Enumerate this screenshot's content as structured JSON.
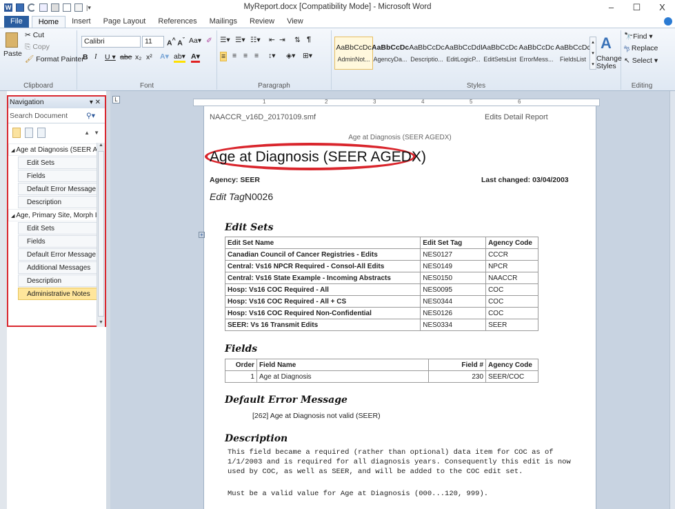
{
  "window": {
    "title": "MyReport.docx [Compatibility Mode] - Microsoft Word",
    "minimize": "–",
    "maximize": "☐",
    "close": "X"
  },
  "tabs": [
    "File",
    "Home",
    "Insert",
    "Page Layout",
    "References",
    "Mailings",
    "Review",
    "View"
  ],
  "ribbon": {
    "clipboard": {
      "label": "Clipboard",
      "paste": "Paste",
      "cut": "Cut",
      "copy": "Copy",
      "format_painter": "Format Painter"
    },
    "font": {
      "label": "Font",
      "name": "Calibri",
      "size": "11"
    },
    "paragraph": {
      "label": "Paragraph"
    },
    "styles": {
      "label": "Styles",
      "items": [
        {
          "sample": "AaBbCcDc",
          "name": "AdminNot..."
        },
        {
          "sample": "AaBbCcDc",
          "name": "AgencyDa..."
        },
        {
          "sample": "AaBbCcDc",
          "name": "Descriptio..."
        },
        {
          "sample": "AaBbCcDdI",
          "name": "EditLogicP..."
        },
        {
          "sample": "AaBbCcDc",
          "name": "EditSetsList"
        },
        {
          "sample": "AaBbCcDc",
          "name": "ErrorMess..."
        },
        {
          "sample": "AaBbCcDc",
          "name": "FieldsList"
        }
      ],
      "change": "Change Styles"
    },
    "editing": {
      "label": "Editing",
      "find": "Find",
      "replace": "Replace",
      "select": "Select"
    }
  },
  "nav": {
    "title": "Navigation",
    "search_placeholder": "Search Document",
    "items": [
      {
        "label": "Age at Diagnosis (SEER A...",
        "level": 1
      },
      {
        "label": "Edit Sets",
        "level": 2
      },
      {
        "label": "Fields",
        "level": 2
      },
      {
        "label": "Default Error Message",
        "level": 2
      },
      {
        "label": "Description",
        "level": 2
      },
      {
        "label": "Age, Primary Site, Morph I...",
        "level": 1
      },
      {
        "label": "Edit Sets",
        "level": 2
      },
      {
        "label": "Fields",
        "level": 2
      },
      {
        "label": "Default Error Message",
        "level": 2
      },
      {
        "label": "Additional Messages",
        "level": 2
      },
      {
        "label": "Description",
        "level": 2
      },
      {
        "label": "Administrative Notes",
        "level": 2,
        "highlighted": true
      }
    ]
  },
  "doc": {
    "header_left": "NAACCR_v16D_20170109.smf",
    "header_right": "Edits Detail Report",
    "subtitle": "Age at Diagnosis (SEER AGEDX)",
    "title": "Age at Diagnosis (SEER AGEDX)",
    "agency": "Agency: SEER",
    "last_changed": "Last changed: 03/04/2003",
    "edit_tag_label": "Edit Tag",
    "edit_tag_value": "N0026",
    "edit_sets_heading": "Edit Sets",
    "edit_sets_cols": [
      "Edit Set Name",
      "Edit Set Tag",
      "Agency Code"
    ],
    "edit_sets_rows": [
      [
        "Canadian Council of Cancer Registries - Edits",
        "NES0127",
        "CCCR"
      ],
      [
        "Central: Vs16 NPCR Required - Consol-All Edits",
        "NES0149",
        "NPCR"
      ],
      [
        "Central: Vs16 State Example - Incoming Abstracts",
        "NES0150",
        "NAACCR"
      ],
      [
        "Hosp: Vs16 COC Required - All",
        "NES0095",
        "COC"
      ],
      [
        "Hosp: Vs16 COC Required - All + CS",
        "NES0344",
        "COC"
      ],
      [
        "Hosp: Vs16 COC Required Non-Confidential",
        "NES0126",
        "COC"
      ],
      [
        "SEER: Vs 16 Transmit Edits",
        "NES0334",
        "SEER"
      ]
    ],
    "fields_heading": "Fields",
    "fields_cols": [
      "Order",
      "Field Name",
      "Field #",
      "Agency Code"
    ],
    "fields_rows": [
      [
        "1",
        "Age at Diagnosis",
        "230",
        "SEER/COC"
      ]
    ],
    "error_heading": "Default Error Message",
    "error_text": "[262] Age at Diagnosis not valid (SEER)",
    "desc_heading": "Description",
    "desc_lines": [
      "This field became a required (rather than optional) data item for COC as of",
      "1/1/2003 and is required for all diagnosis years. Consequently this edit is now",
      "used by COC, as well as SEER, and will be added to the COC edit set."
    ],
    "desc_last": "Must be a valid value for Age at Diagnosis (000...120, 999)."
  },
  "colors": {
    "file_tab": "#2a5d9f",
    "nav_border": "#d9272e",
    "highlight": "#ffe69b",
    "ellipse": "#d9252c"
  }
}
